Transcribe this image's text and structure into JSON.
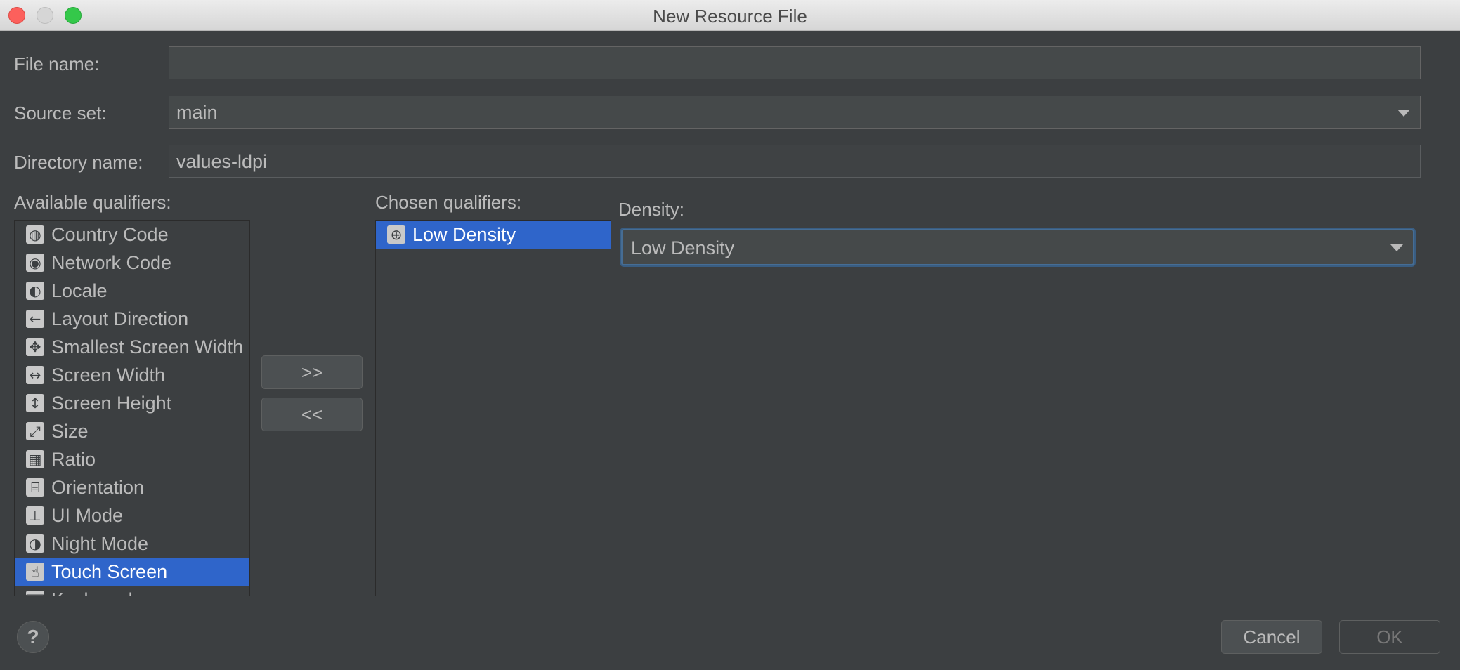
{
  "window": {
    "title": "New Resource File"
  },
  "form": {
    "file_name_label": "File name:",
    "file_name_value": "",
    "source_set_label": "Source set:",
    "source_set_value": "main",
    "directory_name_label": "Directory name:",
    "directory_name_value": "values-ldpi"
  },
  "available": {
    "label": "Available qualifiers:",
    "items": [
      {
        "label": "Country Code",
        "icon": "country-code-icon",
        "glyph": "◍"
      },
      {
        "label": "Network Code",
        "icon": "network-code-icon",
        "glyph": "◉"
      },
      {
        "label": "Locale",
        "icon": "globe-icon",
        "glyph": "◐"
      },
      {
        "label": "Layout Direction",
        "icon": "layout-direction-icon",
        "glyph": "←"
      },
      {
        "label": "Smallest Screen Width",
        "icon": "smallest-width-icon",
        "glyph": "✥"
      },
      {
        "label": "Screen Width",
        "icon": "screen-width-icon",
        "glyph": "↔"
      },
      {
        "label": "Screen Height",
        "icon": "screen-height-icon",
        "glyph": "↕"
      },
      {
        "label": "Size",
        "icon": "size-icon",
        "glyph": "⤢"
      },
      {
        "label": "Ratio",
        "icon": "ratio-icon",
        "glyph": "▦"
      },
      {
        "label": "Orientation",
        "icon": "orientation-icon",
        "glyph": "⌸"
      },
      {
        "label": "UI Mode",
        "icon": "ui-mode-icon",
        "glyph": "⊥"
      },
      {
        "label": "Night Mode",
        "icon": "night-mode-icon",
        "glyph": "◑"
      },
      {
        "label": "Touch Screen",
        "icon": "touch-screen-icon",
        "glyph": "☝"
      },
      {
        "label": "Keyboard",
        "icon": "keyboard-icon",
        "glyph": "⌨"
      }
    ],
    "selected_index": 12
  },
  "buttons": {
    "add": ">>",
    "remove": "<<",
    "cancel": "Cancel",
    "ok": "OK",
    "help": "?"
  },
  "chosen": {
    "label": "Chosen qualifiers:",
    "items": [
      {
        "label": "Low Density",
        "icon": "density-icon",
        "glyph": "⊕"
      }
    ],
    "selected_index": 0
  },
  "density": {
    "label": "Density:",
    "value": "Low Density"
  },
  "colors": {
    "background": "#3c3f41",
    "selection": "#2f65ca",
    "focus": "#466d94"
  }
}
